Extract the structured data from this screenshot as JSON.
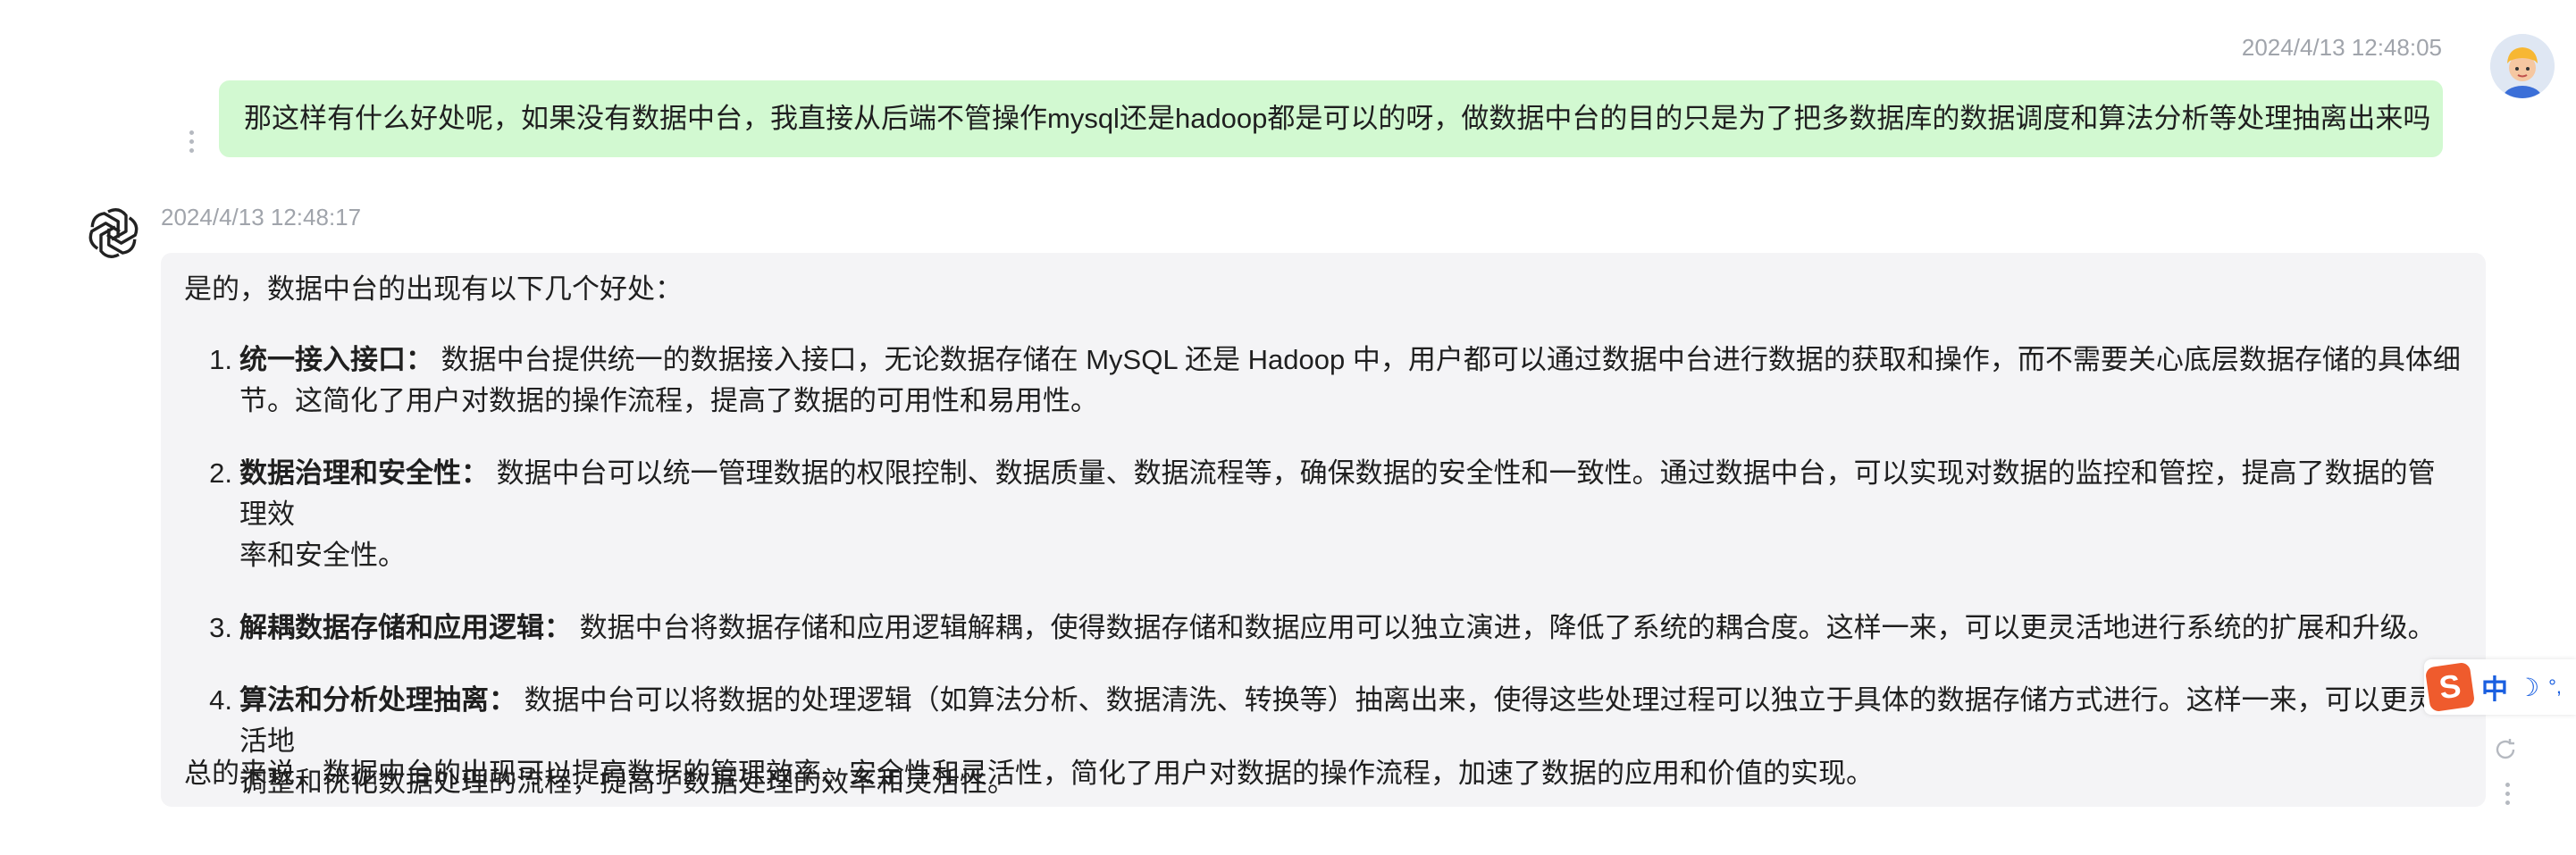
{
  "user_message": {
    "timestamp": "2024/4/13 12:48:05",
    "text": "那这样有什么好处呢，如果没有数据中台，我直接从后端不管操作mysql还是hadoop都是可以的呀，做数据中台的目的只是为了把多数据库的数据调度和算法分析等处理抽离出来吗"
  },
  "ai_message": {
    "timestamp": "2024/4/13 12:48:17",
    "intro": "是的，数据中台的出现有以下几个好处：",
    "points": [
      {
        "num": "1.",
        "head": "统一接入接口：",
        "line1": " 数据中台提供统一的数据接入接口，无论数据存储在 MySQL 还是 Hadoop 中，用户都可以通过数据中台进行数据的获取和操作，而不需要关心底层数据存储的具体细",
        "line2": "节。这简化了用户对数据的操作流程，提高了数据的可用性和易用性。"
      },
      {
        "num": "2.",
        "head": "数据治理和安全性：",
        "line1": " 数据中台可以统一管理数据的权限控制、数据质量、数据流程等，确保数据的安全性和一致性。通过数据中台，可以实现对数据的监控和管控，提高了数据的管理效",
        "line2": "率和安全性。"
      },
      {
        "num": "3.",
        "head": "解耦数据存储和应用逻辑：",
        "line1": " 数据中台将数据存储和应用逻辑解耦，使得数据存储和数据应用可以独立演进，降低了系统的耦合度。这样一来，可以更灵活地进行系统的扩展和升级。",
        "line2": ""
      },
      {
        "num": "4.",
        "head": "算法和分析处理抽离：",
        "line1": " 数据中台可以将数据的处理逻辑（如算法分析、数据清洗、转换等）抽离出来，使得这些处理过程可以独立于具体的数据存储方式进行。这样一来，可以更灵活地",
        "line2": "调整和优化数据处理的流程，提高了数据处理的效率和灵活性。"
      }
    ],
    "outro": "总的来说，数据中台的出现可以提高数据的管理效率、安全性和灵活性，简化了用户对数据的操作流程，加速了数据的应用和价值的实现。"
  },
  "ime_toolbar": {
    "logo": "S",
    "mode": "中",
    "moon": "☽",
    "dot": "°,"
  },
  "icons": {
    "user_avatar": "avatar",
    "ai_logo": "openai-logo-icon",
    "more": "more-vertical-icon",
    "refresh": "refresh-icon"
  }
}
